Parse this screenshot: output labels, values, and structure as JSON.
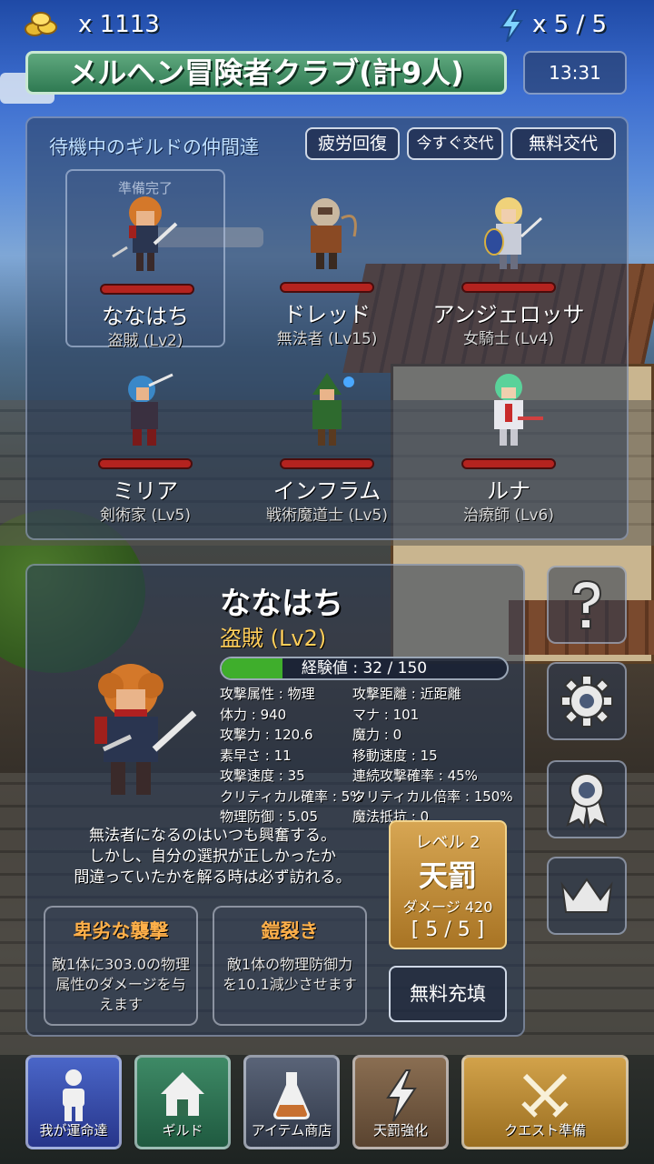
{
  "topbar": {
    "coin_count": "x 1113",
    "stamina": "x 5 / 5"
  },
  "header": {
    "club_title": "メルヘン冒険者クラブ(計9人)",
    "clock": "13:31"
  },
  "guild": {
    "heading": "待機中のギルドの仲間達",
    "buttons": {
      "fatigue": "疲労回復",
      "swap_now": "今すぐ交代",
      "free_swap": "無料交代"
    },
    "members": [
      {
        "name": "ななはち",
        "class": "盗賊 (Lv2)",
        "status": "準備完了"
      },
      {
        "name": "ドレッド",
        "class": "無法者 (Lv15)"
      },
      {
        "name": "アンジェロッサ",
        "class": "女騎士 (Lv4)"
      },
      {
        "name": "ミリア",
        "class": "剣術家 (Lv5)"
      },
      {
        "name": "インフラム",
        "class": "戦術魔道士 (Lv5)"
      },
      {
        "name": "ルナ",
        "class": "治療師 (Lv6)"
      }
    ]
  },
  "detail": {
    "name": "ななはち",
    "class": "盗賊 (Lv2)",
    "exp_text": "経験値 : 32 / 150",
    "exp_fraction": 0.213,
    "stats": [
      [
        "攻撃属性 : 物理",
        "攻撃距離 : 近距離"
      ],
      [
        "体力 : 940",
        "マナ : 101"
      ],
      [
        "攻撃力 : 120.6",
        "魔力 : 0"
      ],
      [
        "素早さ : 11",
        "移動速度 : 15"
      ],
      [
        "攻撃速度 : 35",
        "連続攻撃確率 : 45%"
      ],
      [
        "クリティカル確率 : 5%",
        "クリティカル倍率 : 150%"
      ],
      [
        "物理防御 : 5.05",
        "魔法抵抗 : 0"
      ]
    ],
    "flavor_lines": [
      "無法者になるのはいつも興奮する。",
      "しかし、自分の選択が正しかったか",
      "間違っていたかを解る時は必ず訪れる。"
    ],
    "skills": [
      {
        "name": "卑劣な襲撃",
        "desc": "敵1体に303.0の物理属性のダメージを与えます"
      },
      {
        "name": "鎧裂き",
        "desc": "敵1体の物理防御力を10.1減少させます"
      }
    ]
  },
  "judgment": {
    "level": "レベル 2",
    "title": "天罰",
    "damage": "ダメージ 420",
    "count": "[ 5 / 5 ]",
    "refill": "無料充填"
  },
  "nav": {
    "fate": "我が運命達",
    "guild": "ギルド",
    "shop": "アイテム商店",
    "punish": "天罰強化",
    "quest": "クエスト準備"
  },
  "colors": {
    "hp_bar": "#b4231f",
    "exp_fill": "#3fae2c",
    "skill_name": "#ffb04a",
    "class_highlight": "#ffce5a"
  }
}
